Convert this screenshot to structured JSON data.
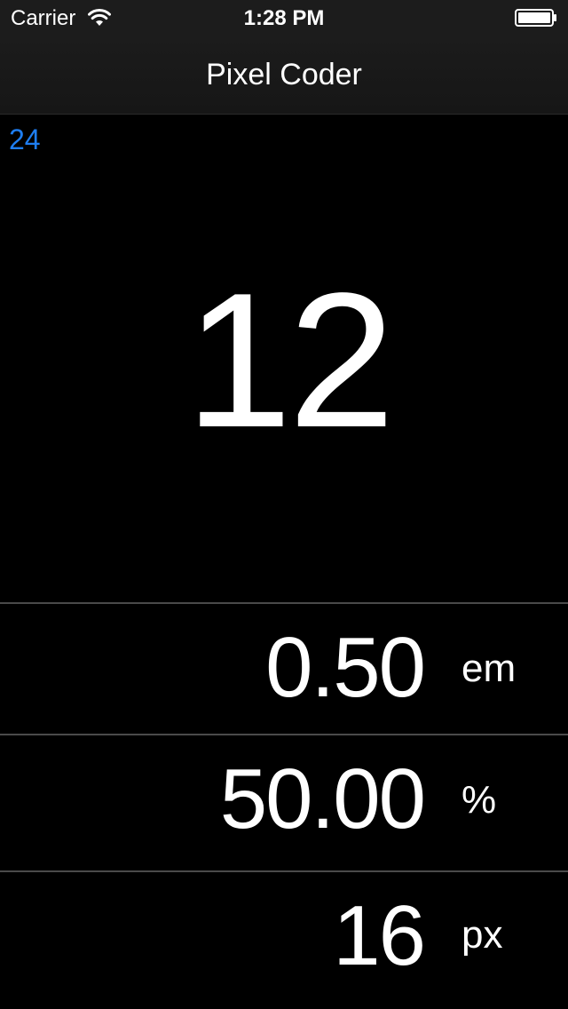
{
  "status_bar": {
    "carrier": "Carrier",
    "time": "1:28 PM",
    "wifi_icon": "wifi-icon",
    "battery_icon": "battery-full-icon"
  },
  "nav": {
    "title": "Pixel Coder"
  },
  "base": {
    "value": "24",
    "color": "#1e7ef2"
  },
  "main": {
    "value": "12"
  },
  "conversions": [
    {
      "value": "0.50",
      "unit": "em"
    },
    {
      "value": "50.00",
      "unit": "%"
    },
    {
      "value": "16",
      "unit": "px"
    }
  ]
}
